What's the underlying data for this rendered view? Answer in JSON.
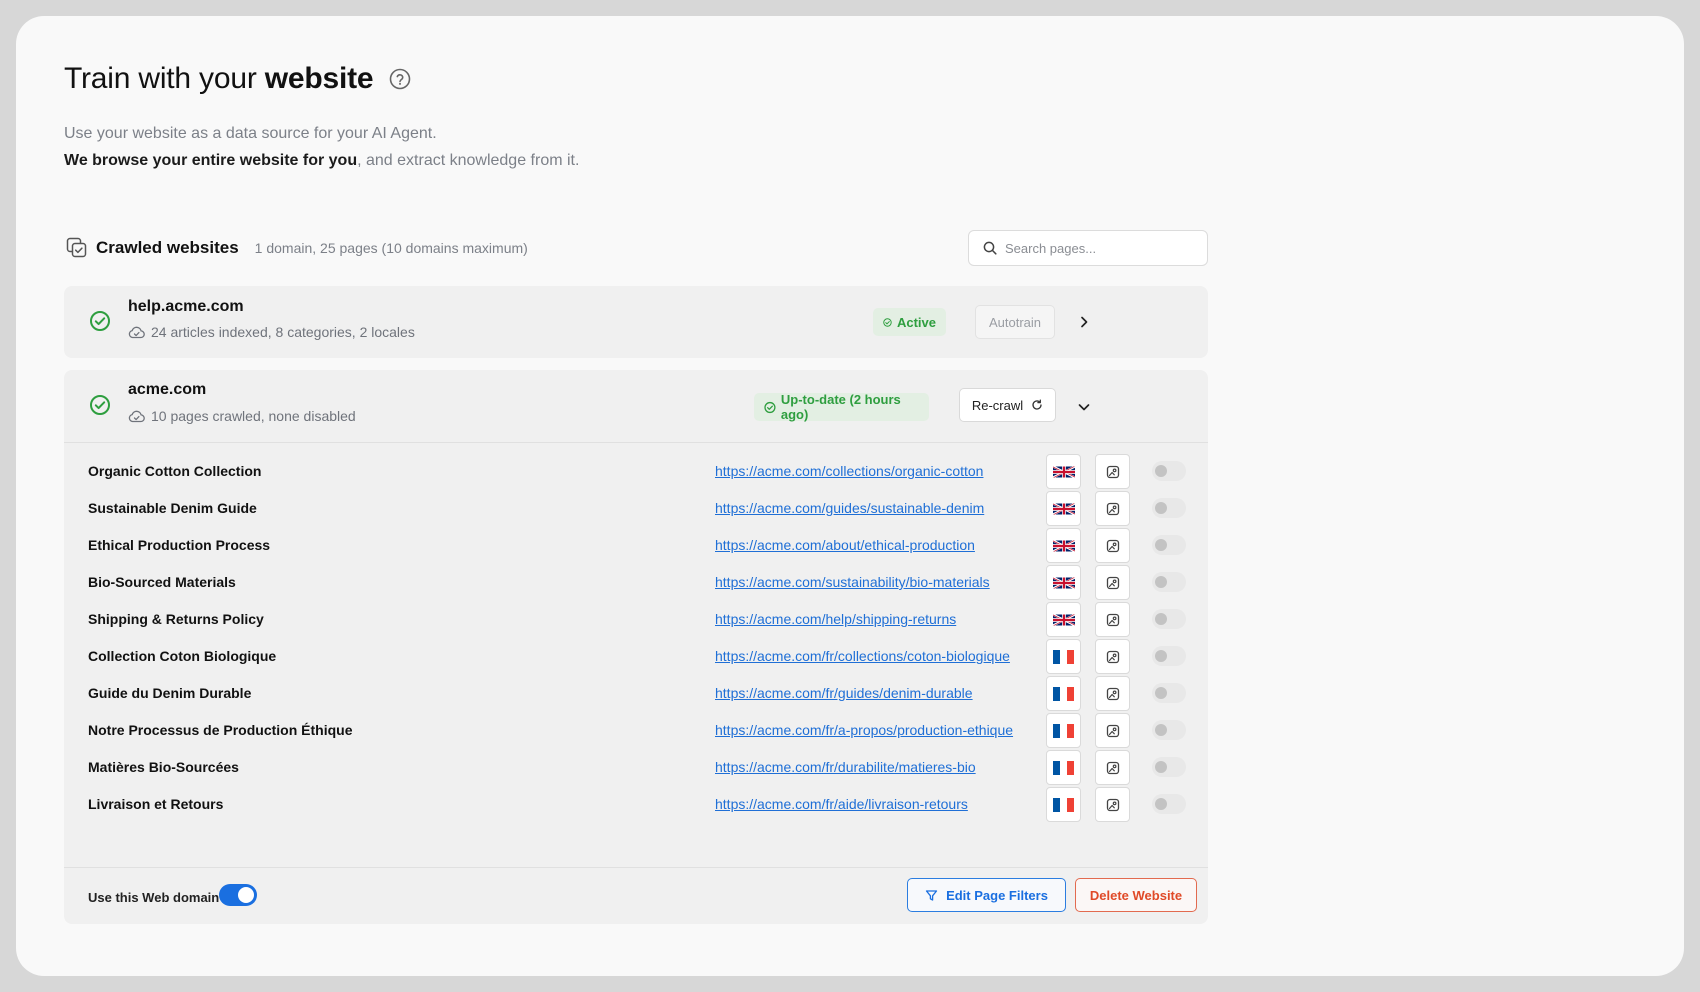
{
  "header": {
    "title_prefix": "Train with your",
    "title_bold": "website",
    "subtitle_line1": "Use your website as a data source for your AI Agent.",
    "subtitle_line2_bold": "We browse your entire website for you",
    "subtitle_line2_rest": ", and extract knowledge from it."
  },
  "crawled": {
    "title": "Crawled websites",
    "meta": "1 domain, 25 pages (10 domains maximum)",
    "search_placeholder": "Search pages..."
  },
  "websites": [
    {
      "domain": "help.acme.com",
      "meta": "24 articles indexed, 8 categories, 2 locales",
      "status": "Active",
      "action": "Autotrain"
    },
    {
      "domain": "acme.com",
      "meta": "10 pages crawled, none disabled",
      "status": "Up-to-date (2 hours ago)",
      "action": "Re-crawl",
      "pages": [
        {
          "title": "Organic Cotton Collection",
          "url": "https://acme.com/collections/organic-cotton",
          "locale": "uk-flag-icon",
          "enabled": false
        },
        {
          "title": "Sustainable Denim Guide",
          "url": "https://acme.com/guides/sustainable-denim",
          "locale": "uk-flag-icon",
          "enabled": false
        },
        {
          "title": "Ethical Production Process",
          "url": "https://acme.com/about/ethical-production",
          "locale": "uk-flag-icon",
          "enabled": false
        },
        {
          "title": "Bio-Sourced Materials",
          "url": "https://acme.com/sustainability/bio-materials",
          "locale": "uk-flag-icon",
          "enabled": false
        },
        {
          "title": "Shipping & Returns Policy",
          "url": "https://acme.com/help/shipping-returns",
          "locale": "uk-flag-icon",
          "enabled": false
        },
        {
          "title": "Collection Coton Biologique",
          "url": "https://acme.com/fr/collections/coton-biologique",
          "locale": "fr-flag-icon",
          "enabled": false
        },
        {
          "title": "Guide du Denim Durable",
          "url": "https://acme.com/fr/guides/denim-durable",
          "locale": "fr-flag-icon",
          "enabled": false
        },
        {
          "title": "Notre Processus de Production Éthique",
          "url": "https://acme.com/fr/a-propos/production-ethique",
          "locale": "fr-flag-icon",
          "enabled": false
        },
        {
          "title": "Matières Bio-Sourcées",
          "url": "https://acme.com/fr/durabilite/matieres-bio",
          "locale": "fr-flag-icon",
          "enabled": false
        },
        {
          "title": "Livraison et Retours",
          "url": "https://acme.com/fr/aide/livraison-retours",
          "locale": "fr-flag-icon",
          "enabled": false
        }
      ],
      "footer": {
        "toggle_label": "Use this Web domain",
        "toggle_on": true,
        "edit_filters": "Edit Page Filters",
        "delete": "Delete Website"
      }
    }
  ],
  "colors": {
    "accent": "#1a6fe0",
    "success": "#2e9e3f",
    "danger": "#e04a28"
  }
}
